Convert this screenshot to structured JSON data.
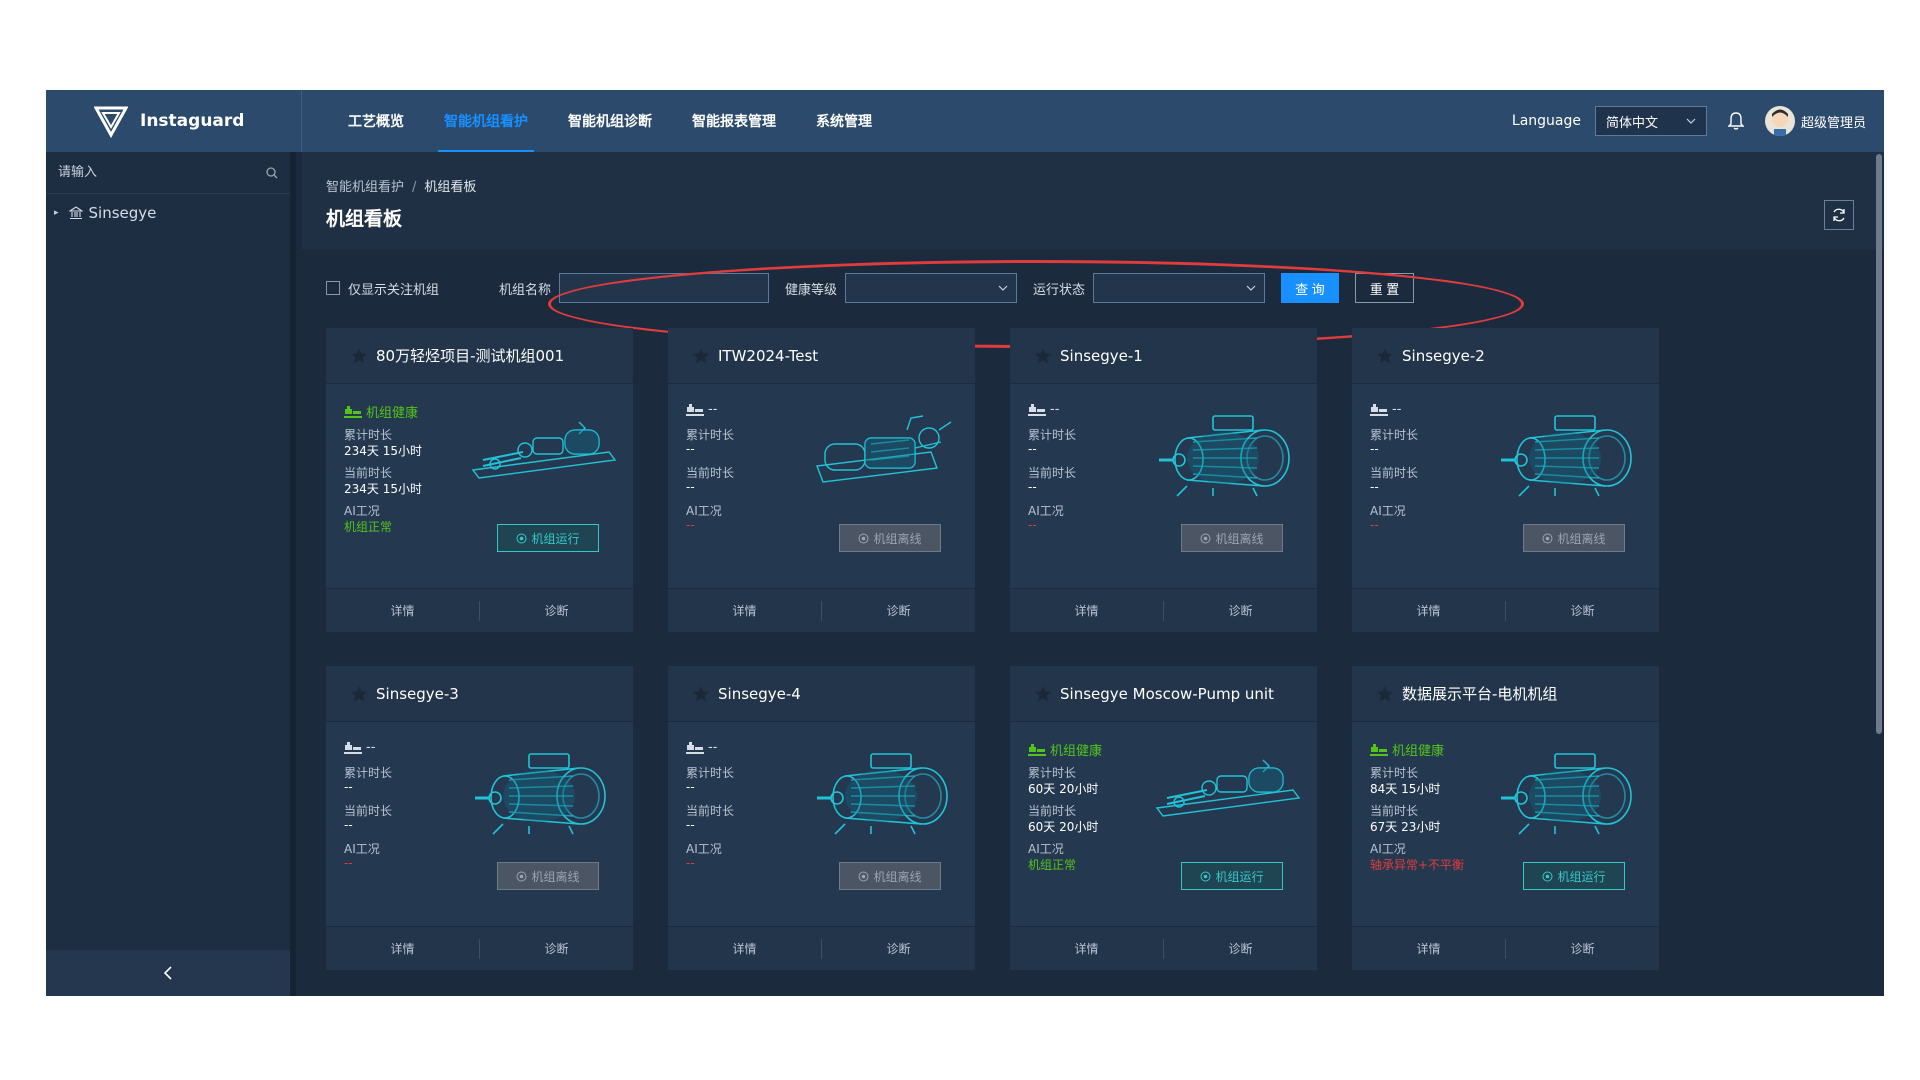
{
  "brand": {
    "name": "Instaguard"
  },
  "nav": [
    {
      "label": "工艺概览"
    },
    {
      "label": "智能机组看护"
    },
    {
      "label": "智能机组诊断"
    },
    {
      "label": "智能报表管理"
    },
    {
      "label": "系统管理"
    }
  ],
  "topright": {
    "language_label": "Language",
    "language_value": "简体中文",
    "user_name": "超级管理员"
  },
  "sidebar": {
    "search_placeholder": "请输入",
    "tree_root": "Sinsegye",
    "collapse_icon": "chevron-left-icon"
  },
  "breadcrumb": {
    "parent": "智能机组看护",
    "separator": "/",
    "current": "机组看板"
  },
  "page": {
    "title": "机组看板"
  },
  "filters": {
    "only_followed_label": "仅显示关注机组",
    "name_label": "机组名称",
    "name_value": "",
    "health_label": "健康等级",
    "health_value": "",
    "run_state_label": "运行状态",
    "run_state_value": "",
    "query_button": "查 询",
    "reset_button": "重 置"
  },
  "colors": {
    "accent": "#1890ff",
    "good": "#52c41a",
    "bad": "#e03c3c",
    "running": "#36c8c8",
    "highlight": "#e03c3c"
  },
  "card_labels": {
    "cumulative": "累计时长",
    "current": "当前时长",
    "ai": "AI工况",
    "detail": "详情",
    "diagnose": "诊断"
  },
  "cards": [
    {
      "title": "80万轻烃项目-测试机组001",
      "health": "机组健康",
      "health_state": "good",
      "cumulative": "234天 15小时",
      "current": "234天 15小时",
      "ai": "机组正常",
      "ai_state": "ok",
      "status": "机组运行",
      "status_state": "run",
      "machine": "pump"
    },
    {
      "title": "ITW2024-Test",
      "health": "--",
      "health_state": "none",
      "cumulative": "--",
      "current": "--",
      "ai": "--",
      "ai_state": "none",
      "status": "机组离线",
      "status_state": "off",
      "machine": "pump-large"
    },
    {
      "title": "Sinsegye-1",
      "health": "--",
      "health_state": "none",
      "cumulative": "--",
      "current": "--",
      "ai": "--",
      "ai_state": "none",
      "status": "机组离线",
      "status_state": "off",
      "machine": "motor"
    },
    {
      "title": "Sinsegye-2",
      "health": "--",
      "health_state": "none",
      "cumulative": "--",
      "current": "--",
      "ai": "--",
      "ai_state": "none",
      "status": "机组离线",
      "status_state": "off",
      "machine": "motor"
    },
    {
      "title": "Sinsegye-3",
      "health": "--",
      "health_state": "none",
      "cumulative": "--",
      "current": "--",
      "ai": "--",
      "ai_state": "none",
      "status": "机组离线",
      "status_state": "off",
      "machine": "motor"
    },
    {
      "title": "Sinsegye-4",
      "health": "--",
      "health_state": "none",
      "cumulative": "--",
      "current": "--",
      "ai": "--",
      "ai_state": "none",
      "status": "机组离线",
      "status_state": "off",
      "machine": "motor"
    },
    {
      "title": "Sinsegye Moscow-Pump unit",
      "health": "机组健康",
      "health_state": "good",
      "cumulative": "60天 20小时",
      "current": "60天 20小时",
      "ai": "机组正常",
      "ai_state": "ok",
      "status": "机组运行",
      "status_state": "run",
      "machine": "pump"
    },
    {
      "title": "数据展示平台-电机机组",
      "health": "机组健康",
      "health_state": "good",
      "cumulative": "84天 15小时",
      "current": "67天 23小时",
      "ai": "轴承异常+不平衡",
      "ai_state": "bad",
      "status": "机组运行",
      "status_state": "run",
      "machine": "motor"
    }
  ]
}
